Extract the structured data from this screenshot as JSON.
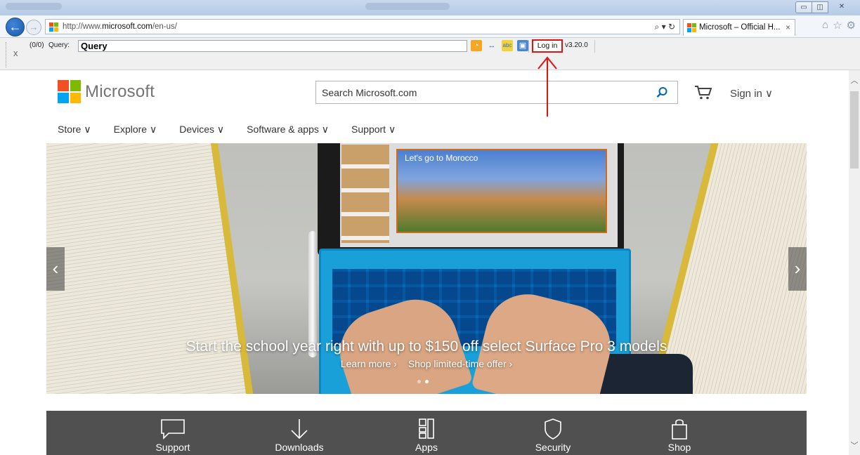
{
  "browser": {
    "url_prefix": "http://www.",
    "url_domain": "microsoft.com",
    "url_path": "/en-us/",
    "address_tools": "⌕ ▾ ↻",
    "tab_title": "Microsoft – Official H...",
    "tab_close": "×",
    "window_controls": [
      "▭",
      "◫",
      "✕"
    ]
  },
  "extension_bar": {
    "close": "x",
    "count": "(0/0)",
    "query_label": "Query:",
    "query_value": "Query",
    "login_label": "Log in",
    "version": "v3.20.0"
  },
  "site": {
    "brand": "Microsoft",
    "search_placeholder": "Search Microsoft.com",
    "signin": "Sign in ∨",
    "menu": [
      "Store ∨",
      "Explore ∨",
      "Devices ∨",
      "Software & apps ∨",
      "Support ∨"
    ],
    "hero": {
      "slide_caption": "Let's go to Morocco",
      "title": "Start the school year right with up to $150 off select Surface Pro 3 models",
      "link1": "Learn more ›",
      "link2": "Shop limited-time offer ›",
      "prev": "‹",
      "next": "›"
    },
    "tiles": [
      "Support",
      "Downloads",
      "Apps",
      "Security",
      "Shop"
    ]
  },
  "colors": {
    "annotation_red": "#e01313",
    "tile_bg": "#505050",
    "keyboard_blue": "#1aa0d8"
  },
  "icons": [
    "back-arrow-icon",
    "forward-arrow-icon",
    "search-icon",
    "refresh-icon",
    "home-icon",
    "star-icon",
    "gear-icon",
    "cart-icon",
    "chat-icon",
    "download-icon",
    "apps-icon",
    "shield-icon",
    "bag-icon"
  ]
}
